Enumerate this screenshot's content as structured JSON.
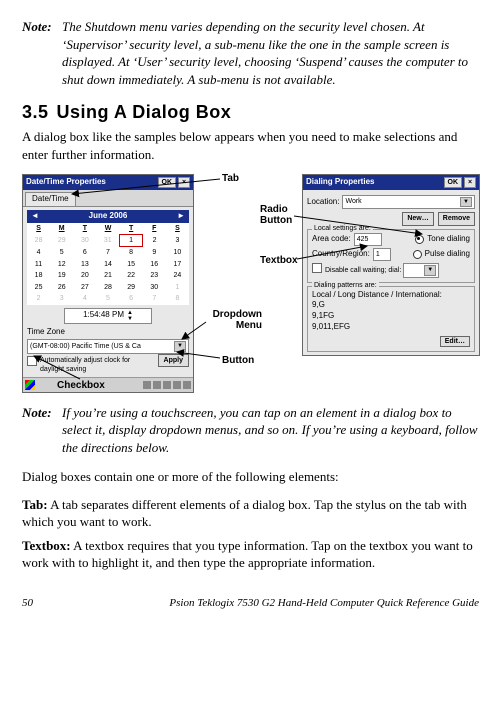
{
  "note1": {
    "label": "Note:",
    "text": "The Shutdown menu varies depending on the security level chosen. At ‘Supervisor’ security level, a sub-menu like the one in the sample screen is displayed. At ‘User’ security level, choosing ‘Suspend’ causes the computer to shut down immediately. A sub-menu is not available."
  },
  "heading": {
    "num": "3.5",
    "text": "Using A Dialog Box"
  },
  "intro": "A dialog box like the samples below appears when you need to make selections and enter further information.",
  "annots": {
    "tab": "Tab",
    "radio": "Radio Button",
    "textbox_a": "Textbox",
    "dropdown": "Dropdown Menu",
    "button": "Button",
    "checkbox": "Checkbox"
  },
  "dlg1": {
    "title": "Date/Time Properties",
    "ok": "OK",
    "tab": "Date/Time",
    "cal_month": "June 2006",
    "cal_dow": [
      "S",
      "M",
      "T",
      "W",
      "T",
      "F",
      "S"
    ],
    "cal_weeks": [
      [
        "28",
        "29",
        "30",
        "31",
        "1",
        "2",
        "3"
      ],
      [
        "4",
        "5",
        "6",
        "7",
        "8",
        "9",
        "10"
      ],
      [
        "11",
        "12",
        "13",
        "14",
        "15",
        "16",
        "17"
      ],
      [
        "18",
        "19",
        "20",
        "21",
        "22",
        "23",
        "24"
      ],
      [
        "25",
        "26",
        "27",
        "28",
        "29",
        "30",
        "1"
      ],
      [
        "2",
        "3",
        "4",
        "5",
        "6",
        "7",
        "8"
      ]
    ],
    "today": "1",
    "time": "1:54:48 PM",
    "tz_label": "Time Zone",
    "tz_value": "(GMT-08:00) Pacific Time (US & Ca",
    "chk": "Automatically adjust clock for daylight saving",
    "apply": "Apply"
  },
  "dlg2": {
    "title": "Dialing Properties",
    "ok": "OK",
    "loc_label": "Location:",
    "loc_value": "Work",
    "new": "New…",
    "remove": "Remove",
    "grp1_title": "Local settings are:",
    "area_label": "Area code:",
    "area_value": "425",
    "tone": "Tone dialing",
    "pulse": "Pulse dialing",
    "country_label": "Country/Region:",
    "country_value": "1",
    "cw_label": "Disable call waiting; dial:",
    "grp2_title": "Dialing patterns are:",
    "pat_label": "Local / Long Distance / International:",
    "pat1": "9,G",
    "pat2": "9,1FG",
    "pat3": "9,011,EFG",
    "edit": "Edit…"
  },
  "note2": {
    "label": "Note:",
    "text": "If you’re using a touchscreen, you can tap on an element in a dialog box to select it, display dropdown menus, and so on. If you’re using a keyboard, follow the directions below."
  },
  "para2": "Dialog boxes contain one or more of the following elements:",
  "defTab": {
    "lead": "Tab:",
    "text": " A tab separates different elements of a dialog box. Tap the stylus on the tab with which you want to work."
  },
  "defTextbox": {
    "lead": "Textbox:",
    "text": " A textbox requires that you type information. Tap on the textbox you want to work with to highlight it, and then type the appropriate information."
  },
  "footer": {
    "page": "50",
    "doc": "Psion Teklogix 7530 G2 Hand-Held Computer Quick Reference Guide"
  }
}
